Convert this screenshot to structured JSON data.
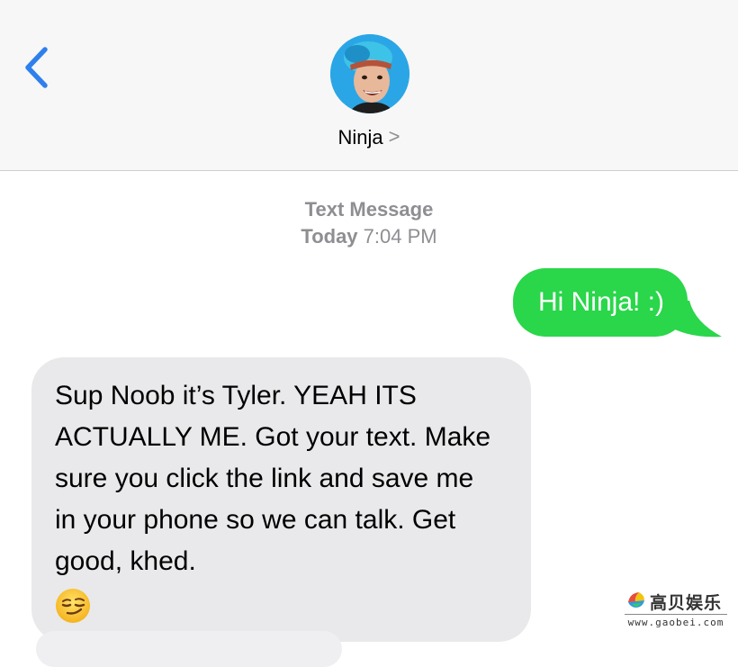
{
  "header": {
    "contact_name": "Ninja",
    "contact_chevron": ">",
    "accent_color": "#2f80ed"
  },
  "thread": {
    "message_type": "Text Message",
    "day": "Today",
    "time": "7:04 PM"
  },
  "messages": [
    {
      "direction": "sent",
      "text": "Hi Ninja! :)",
      "bubble_color": "#2ad64a"
    },
    {
      "direction": "received",
      "text": "Sup Noob it’s Tyler. YEAH ITS ACTUALLY ME. Got your text. Make sure you click the link and save me in your phone so we can talk. Get good, khed.",
      "emoji": "smirking-face",
      "bubble_color": "#e9e9eb"
    }
  ],
  "watermark": {
    "brand_text": "高贝娱乐",
    "url": "www.gaobei.com"
  }
}
